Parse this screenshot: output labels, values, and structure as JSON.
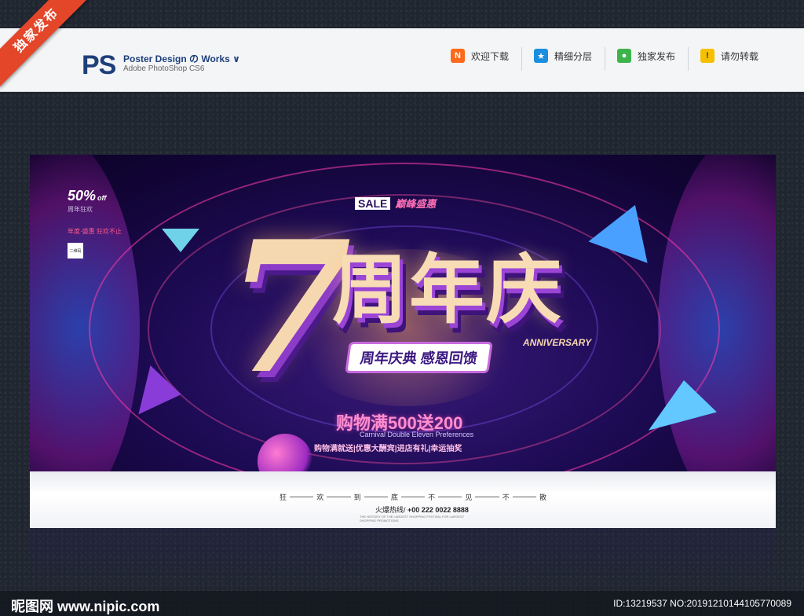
{
  "ribbon": {
    "label": "独家发布"
  },
  "header": {
    "logo": "PS",
    "title": "Poster Design の Works ∨",
    "subtitle": "Adobe PhotoShop CS6",
    "nav": [
      {
        "icon": "N",
        "label": "欢迎下载",
        "color": "#ff6a1a"
      },
      {
        "icon": "★",
        "label": "精细分层",
        "color": "#1a8fe0"
      },
      {
        "icon": "●",
        "label": "独家发布",
        "color": "#3cb44a"
      },
      {
        "icon": "!",
        "label": "请勿转载",
        "color": "#f6c000"
      }
    ]
  },
  "poster": {
    "badge_pct": "50%",
    "badge_off": "off",
    "badge_small": "周年狂欢",
    "side_note": "年度·盛惠 狂欢不止",
    "qr_label": "二维码",
    "sale_tag": "SALE",
    "sale_text": "巅峰盛惠",
    "big_number": "7",
    "main_title": "周年庆",
    "anniversary": "ANNIVERSARY",
    "ribbon_text": "周年庆典 感恩回馈",
    "promo_line": "购物满500送200",
    "promo_en": "Carnival Double Eleven Preferences",
    "promo_list": "购物满就送|优惠大酬宾|进店有礼|幸运抽奖",
    "bottom_slogan": [
      "狂",
      "欢",
      "到",
      "底",
      "不",
      "见",
      "不",
      "散"
    ],
    "hotline_label": "火爆热线/",
    "hotline_number": "+00 222  0022 8888",
    "fine_print": "THE HISTORY OF THE LARGEST SHOPPING FESTIVAL FOR LARGEST SHOPPING PROMOTIONS"
  },
  "footer": {
    "site_logo": "昵图网 www.nipic.com",
    "id_text": "ID:13219537 NO:20191210144105770089"
  }
}
